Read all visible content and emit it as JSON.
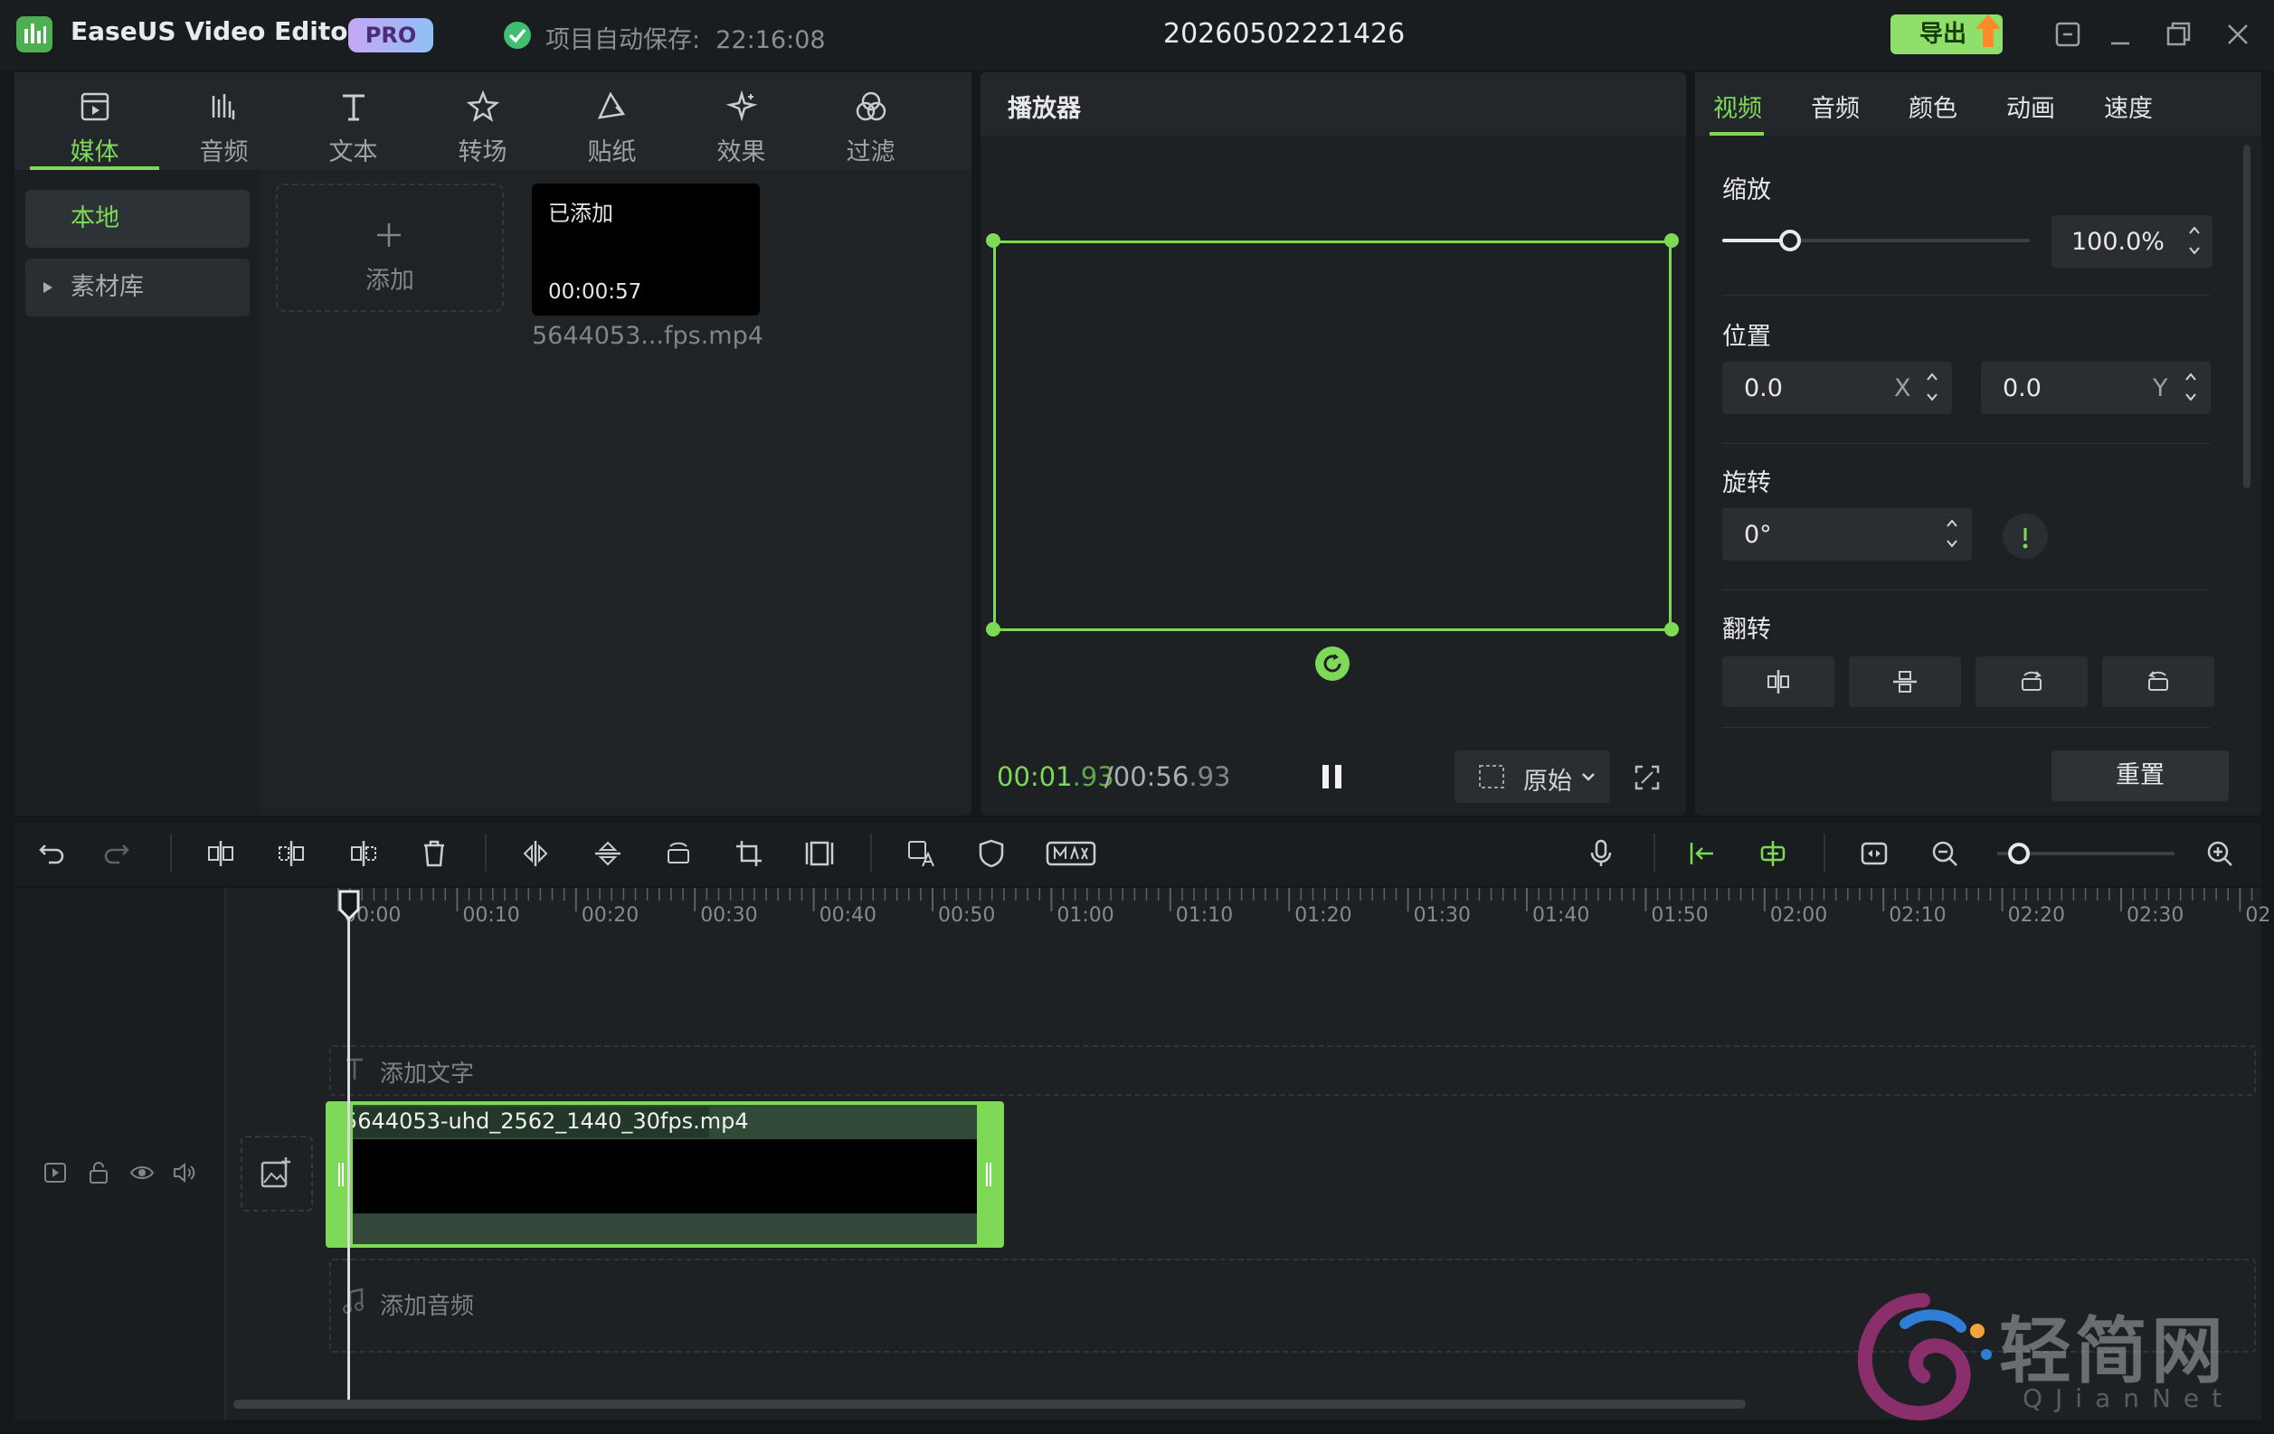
{
  "app": {
    "name": "EaseUS Video Editor",
    "badge": "PRO",
    "autosave_label": "项目自动保存:",
    "autosave_time": "22:16:08",
    "project_title": "20260502221426",
    "export_label": "导出",
    "accent_color": "#7ed957"
  },
  "media_tabs": [
    {
      "label": "媒体",
      "icon": "media-icon",
      "active": true
    },
    {
      "label": "音频",
      "icon": "audio-icon"
    },
    {
      "label": "文本",
      "icon": "text-icon"
    },
    {
      "label": "转场",
      "icon": "transition-icon"
    },
    {
      "label": "贴纸",
      "icon": "sticker-icon"
    },
    {
      "label": "效果",
      "icon": "effects-icon"
    },
    {
      "label": "过滤",
      "icon": "filter-icon"
    }
  ],
  "sidebar": {
    "local": "本地",
    "library": "素材库"
  },
  "media_grid": {
    "add_label": "添加",
    "item": {
      "status": "已添加",
      "duration": "00:00:57",
      "name": "5644053...fps.mp4"
    }
  },
  "player": {
    "title": "播放器",
    "time_current_main": "00:01",
    "time_current_frac": ".93",
    "time_total_main": "00:56",
    "time_total_frac": ".93",
    "ratio_label": "原始"
  },
  "props": {
    "tabs": [
      "视频",
      "音频",
      "颜色",
      "动画",
      "速度"
    ],
    "active_tab": "视频",
    "scale_label": "缩放",
    "scale_value": "100.0%",
    "scale_fraction": 0.22,
    "position_label": "位置",
    "pos_x": "0.0",
    "pos_x_axis": "X",
    "pos_y": "0.0",
    "pos_y_axis": "Y",
    "rotate_label": "旋转",
    "rotate_value": "0°",
    "flip_label": "翻转",
    "reset_label": "重置"
  },
  "timeline": {
    "ticks": [
      "00:00",
      "00:10",
      "00:20",
      "00:30",
      "00:40",
      "00:50",
      "01:00",
      "01:10",
      "01:20",
      "01:30",
      "01:40",
      "01:50",
      "02:00",
      "02:10",
      "02:20",
      "02:30",
      "02"
    ],
    "add_text": "添加文字",
    "add_audio": "添加音频",
    "clip_name": "5644053-uhd_2562_1440_30fps.mp4"
  },
  "watermark": {
    "text": "轻简网",
    "sub": "QJianNet"
  }
}
